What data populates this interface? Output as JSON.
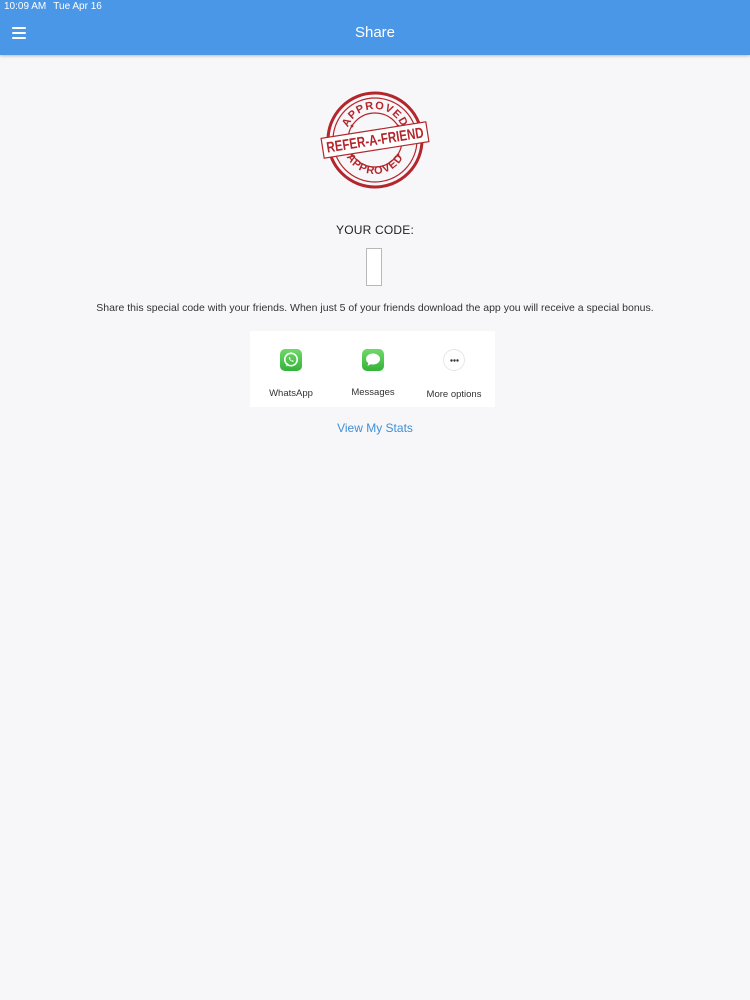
{
  "status_bar": {
    "time": "10:09 AM",
    "date": "Tue Apr 16"
  },
  "header": {
    "title": "Share",
    "menu_icon": "hamburger-menu-icon"
  },
  "stamp": {
    "top_text": "APPROVED",
    "center_text": "REFER-A-FRIEND",
    "bottom_text": "APPROVED",
    "color": "#b3262c"
  },
  "code_section": {
    "label": "YOUR CODE:",
    "code": ""
  },
  "description": "Share this special code with your friends. When just 5 of your friends download the app you will receive a special bonus.",
  "share_options": [
    {
      "label": "WhatsApp",
      "icon": "whatsapp-icon"
    },
    {
      "label": "Messages",
      "icon": "messages-icon"
    },
    {
      "label": "More options",
      "icon": "more-options-icon"
    }
  ],
  "stats_link": "View My Stats",
  "colors": {
    "header_bg": "#4a97e8",
    "link": "#3f8fd7",
    "share_green": "#4cc04a"
  }
}
